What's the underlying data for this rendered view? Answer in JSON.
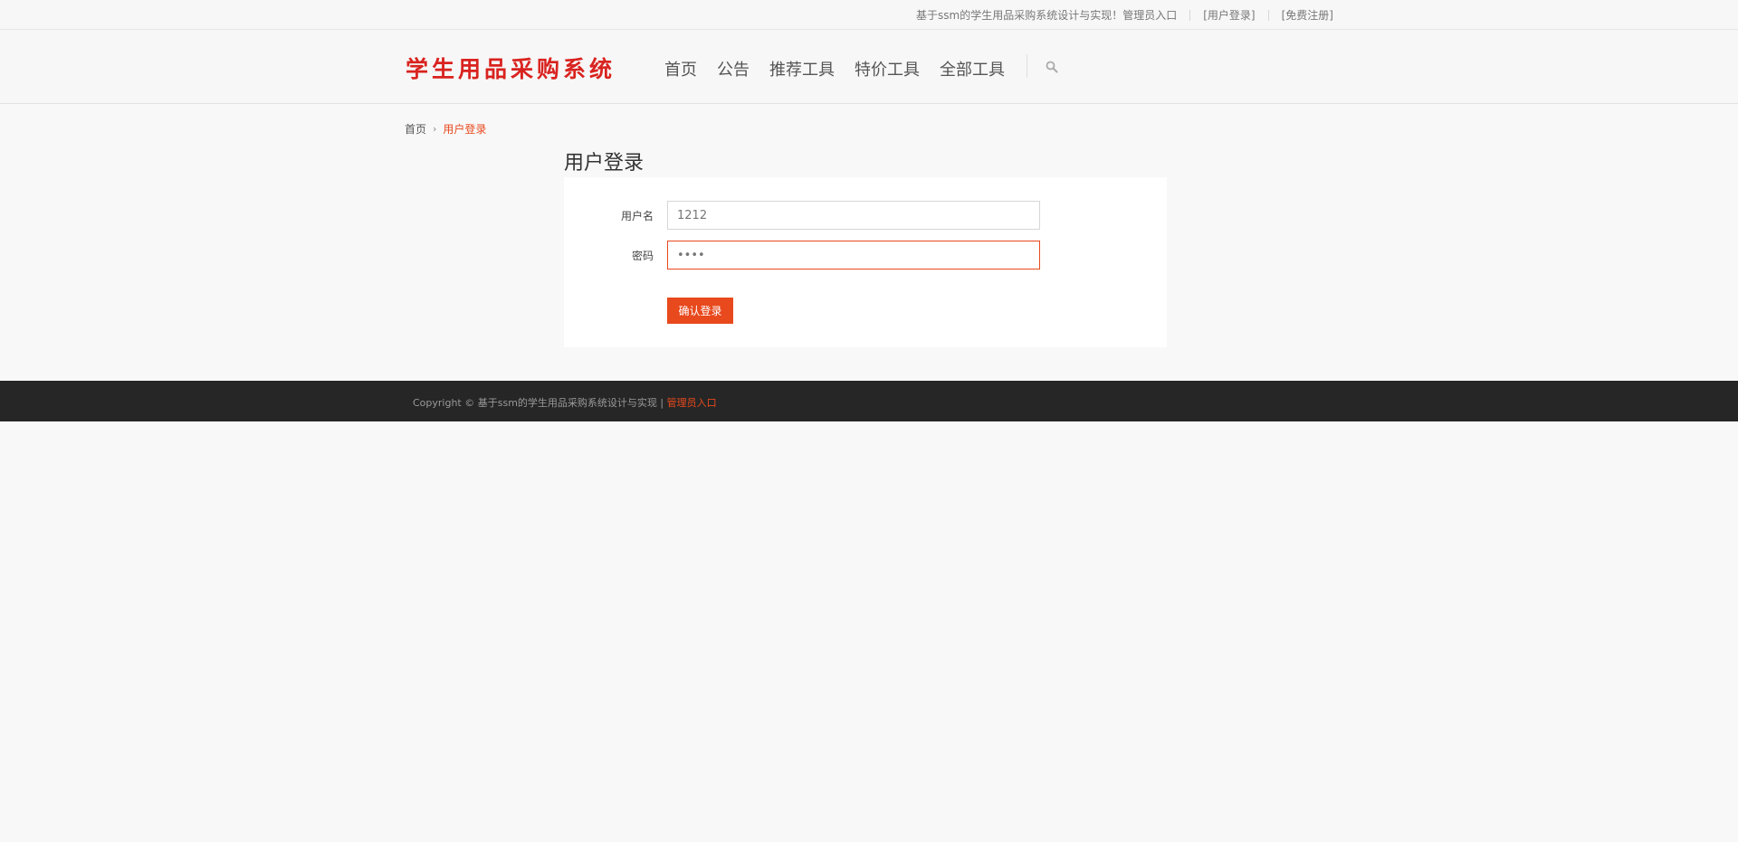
{
  "topbar": {
    "welcome": "基于ssm的学生用品采购系统设计与实现！",
    "admin_link": "管理员入口",
    "login_link": "[用户登录]",
    "register_link": "[免费注册]"
  },
  "header": {
    "logo": "学生用品采购系统",
    "nav": [
      {
        "label": "首页"
      },
      {
        "label": "公告"
      },
      {
        "label": "推荐工具"
      },
      {
        "label": "特价工具"
      },
      {
        "label": "全部工具"
      }
    ],
    "search_icon": "search-icon"
  },
  "breadcrumb": {
    "home": "首页",
    "separator": "›",
    "current": "用户登录"
  },
  "login": {
    "title": "用户登录",
    "username_label": "用户名",
    "username_value": "1212",
    "password_label": "密码",
    "password_value": "1234",
    "submit_label": "确认登录"
  },
  "footer": {
    "copyright": "Copyright © 基于ssm的学生用品采购系统设计与实现 | ",
    "admin_link": "管理员入口"
  },
  "colors": {
    "accent": "#e8491d",
    "logo": "#d9231f",
    "footer_bg": "#262626",
    "page_bg": "#f8f8f8"
  }
}
